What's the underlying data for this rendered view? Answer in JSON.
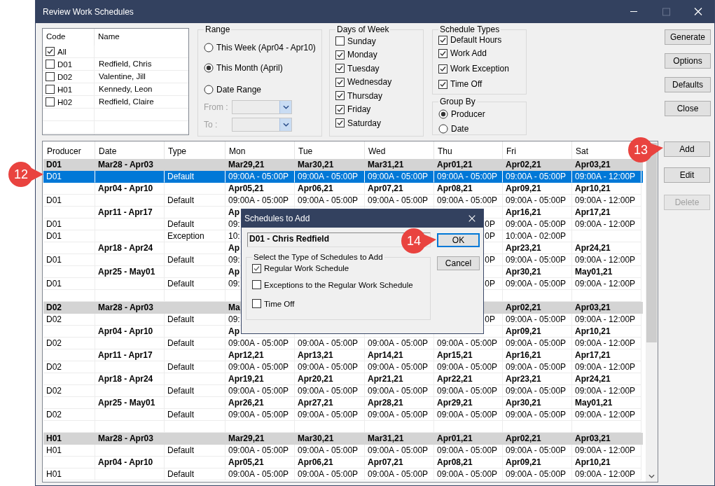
{
  "window": {
    "title": "Review Work Schedules",
    "controls": [
      {
        "kind": "minimize",
        "disabled": false
      },
      {
        "kind": "maximize",
        "disabled": true
      },
      {
        "kind": "close",
        "disabled": false
      }
    ]
  },
  "code_list": {
    "columns": [
      "Code",
      "Name"
    ],
    "rows": [
      {
        "code": "All",
        "checked": true
      },
      {
        "code": "D01",
        "name": "Redfield, Chris",
        "checked": false
      },
      {
        "code": "D02",
        "name": "Valentine, Jill",
        "checked": false
      },
      {
        "code": "H01",
        "name": "Kennedy, Leon",
        "checked": false
      },
      {
        "code": "H02",
        "name": "Redfield, Claire",
        "checked": false
      }
    ]
  },
  "range": {
    "title": "Range",
    "options": [
      {
        "label": "This Week (Apr04 - Apr10)",
        "selected": false
      },
      {
        "label": "This Month (April)",
        "selected": true
      },
      {
        "label": "Date Range",
        "selected": false
      }
    ],
    "from_label": "From :",
    "to_label": "To :",
    "dates_disabled": true
  },
  "days_of_week": {
    "title": "Days of Week",
    "days": [
      {
        "label": "Sunday",
        "checked": false
      },
      {
        "label": "Monday",
        "checked": true
      },
      {
        "label": "Tuesday",
        "checked": true
      },
      {
        "label": "Wednesday",
        "checked": true
      },
      {
        "label": "Thursday",
        "checked": true
      },
      {
        "label": "Friday",
        "checked": true
      },
      {
        "label": "Saturday",
        "checked": true
      }
    ]
  },
  "schedule_types": {
    "title": "Schedule Types",
    "types": [
      {
        "label": "Default Hours",
        "checked": true
      },
      {
        "label": "Work Add",
        "checked": true
      },
      {
        "label": "Work Exception",
        "checked": true
      },
      {
        "label": "Time Off",
        "checked": true
      }
    ]
  },
  "group_by": {
    "title": "Group By",
    "options": [
      {
        "label": "Producer",
        "selected": true
      },
      {
        "label": "Date",
        "selected": false
      }
    ]
  },
  "top_buttons": [
    {
      "label": "Generate",
      "disabled": false
    },
    {
      "label": "Options",
      "disabled": false
    },
    {
      "label": "Defaults",
      "disabled": false
    },
    {
      "label": "Close",
      "disabled": false
    }
  ],
  "table": {
    "callout": "12",
    "columns": [
      "Producer",
      "Date",
      "Type",
      "Mon",
      "Tue",
      "Wed",
      "Thu",
      "Fri",
      "Sat"
    ],
    "rows": [
      {
        "kind": "group",
        "selected": false,
        "cells": [
          "D01",
          "Mar28 - Apr03",
          null,
          "Mar29,21",
          "Mar30,21",
          "Mar31,21",
          "Apr01,21",
          "Apr02,21",
          "Apr03,21"
        ]
      },
      {
        "kind": "entry",
        "selected": true,
        "cells": [
          "D01",
          null,
          "Default",
          "09:00A - 05:00P",
          "09:00A - 05:00P",
          "09:00A - 05:00P",
          "09:00A - 05:00P",
          "09:00A - 05:00P",
          "09:00A - 12:00P"
        ]
      },
      {
        "kind": "week",
        "selected": false,
        "cells": [
          null,
          "Apr04 - Apr10",
          null,
          "Apr05,21",
          "Apr06,21",
          "Apr07,21",
          "Apr08,21",
          "Apr09,21",
          "Apr10,21"
        ]
      },
      {
        "kind": "entry",
        "selected": false,
        "cells": [
          "D01",
          null,
          "Default",
          "09:00A - 05:00P",
          "09:00A - 05:00P",
          "09:00A - 05:00P",
          "09:00A - 05:00P",
          "09:00A - 05:00P",
          "09:00A - 12:00P"
        ]
      },
      {
        "kind": "week",
        "selected": false,
        "cells": [
          null,
          "Apr11 - Apr17",
          null,
          "Ap",
          null,
          null,
          null,
          "Apr16,21",
          "Apr17,21"
        ]
      },
      {
        "kind": "entry",
        "selected": false,
        "cells": [
          "D01",
          null,
          "Default",
          "09:",
          null,
          null,
          {
            "text": "0P",
            "clipped_start": true
          },
          "09:00A - 05:00P",
          "09:00A - 12:00P"
        ]
      },
      {
        "kind": "entry",
        "selected": false,
        "cells": [
          "D01",
          null,
          "Exception",
          "10:",
          null,
          null,
          {
            "text": "0P",
            "clipped_start": true
          },
          "10:00A - 02:00P",
          null
        ]
      },
      {
        "kind": "week",
        "selected": false,
        "cells": [
          null,
          "Apr18 - Apr24",
          null,
          "Ap",
          null,
          null,
          null,
          "Apr23,21",
          "Apr24,21"
        ]
      },
      {
        "kind": "entry",
        "selected": false,
        "cells": [
          "D01",
          null,
          "Default",
          "09:",
          null,
          null,
          {
            "text": "0P",
            "clipped_start": true
          },
          "09:00A - 05:00P",
          "09:00A - 12:00P"
        ]
      },
      {
        "kind": "week",
        "selected": false,
        "cells": [
          null,
          "Apr25 - May01",
          null,
          "Ap",
          null,
          null,
          null,
          "Apr30,21",
          "May01,21"
        ]
      },
      {
        "kind": "entry",
        "selected": false,
        "cells": [
          "D01",
          null,
          "Default",
          "09:",
          null,
          null,
          {
            "text": "0P",
            "clipped_start": true
          },
          "09:00A - 05:00P",
          "09:00A - 12:00P"
        ]
      },
      {
        "kind": "blank",
        "selected": false
      },
      {
        "kind": "group",
        "selected": false,
        "cells": [
          "D02",
          "Mar28 - Apr03",
          null,
          "Ma",
          null,
          null,
          null,
          "Apr02,21",
          "Apr03,21"
        ]
      },
      {
        "kind": "entry",
        "selected": false,
        "cells": [
          "D02",
          null,
          "Default",
          "09:",
          null,
          null,
          {
            "text": "0P",
            "clipped_start": true
          },
          "09:00A - 05:00P",
          "09:00A - 12:00P"
        ]
      },
      {
        "kind": "week",
        "selected": false,
        "cells": [
          null,
          "Apr04 - Apr10",
          null,
          "Ap",
          null,
          null,
          null,
          "Apr09,21",
          "Apr10,21"
        ]
      },
      {
        "kind": "entry",
        "selected": false,
        "cells": [
          "D02",
          null,
          "Default",
          "09:00A - 05:00P",
          "09:00A - 05:00P",
          "09:00A - 05:00P",
          "09:00A - 05:00P",
          "09:00A - 05:00P",
          "09:00A - 12:00P"
        ]
      },
      {
        "kind": "week",
        "selected": false,
        "cells": [
          null,
          "Apr11 - Apr17",
          null,
          "Apr12,21",
          "Apr13,21",
          "Apr14,21",
          "Apr15,21",
          "Apr16,21",
          "Apr17,21"
        ]
      },
      {
        "kind": "entry",
        "selected": false,
        "cells": [
          "D02",
          null,
          "Default",
          "09:00A - 05:00P",
          "09:00A - 05:00P",
          "09:00A - 05:00P",
          "09:00A - 05:00P",
          "09:00A - 05:00P",
          "09:00A - 12:00P"
        ]
      },
      {
        "kind": "week",
        "selected": false,
        "cells": [
          null,
          "Apr18 - Apr24",
          null,
          "Apr19,21",
          "Apr20,21",
          "Apr21,21",
          "Apr22,21",
          "Apr23,21",
          "Apr24,21"
        ]
      },
      {
        "kind": "entry",
        "selected": false,
        "cells": [
          "D02",
          null,
          "Default",
          "09:00A - 05:00P",
          "09:00A - 05:00P",
          "09:00A - 05:00P",
          "09:00A - 05:00P",
          "09:00A - 05:00P",
          "09:00A - 12:00P"
        ]
      },
      {
        "kind": "week",
        "selected": false,
        "cells": [
          null,
          "Apr25 - May01",
          null,
          "Apr26,21",
          "Apr27,21",
          "Apr28,21",
          "Apr29,21",
          "Apr30,21",
          "May01,21"
        ]
      },
      {
        "kind": "entry",
        "selected": false,
        "cells": [
          "D02",
          null,
          "Default",
          "09:00A - 05:00P",
          "09:00A - 05:00P",
          "09:00A - 05:00P",
          "09:00A - 05:00P",
          "09:00A - 05:00P",
          "09:00A - 12:00P"
        ]
      },
      {
        "kind": "blank",
        "selected": false
      },
      {
        "kind": "group",
        "selected": false,
        "cells": [
          "H01",
          "Mar28 - Apr03",
          null,
          "Mar29,21",
          "Mar30,21",
          "Mar31,21",
          "Apr01,21",
          "Apr02,21",
          "Apr03,21"
        ]
      },
      {
        "kind": "entry",
        "selected": false,
        "cells": [
          "H01",
          null,
          "Default",
          "09:00A - 05:00P",
          "09:00A - 05:00P",
          "09:00A - 05:00P",
          "09:00A - 05:00P",
          "09:00A - 05:00P",
          "09:00A - 12:00P"
        ]
      },
      {
        "kind": "week",
        "selected": false,
        "cells": [
          null,
          "Apr04 - Apr10",
          null,
          "Apr05,21",
          "Apr06,21",
          "Apr07,21",
          "Apr08,21",
          "Apr09,21",
          "Apr10,21"
        ]
      },
      {
        "kind": "entry",
        "selected": false,
        "cells": [
          "H01",
          null,
          "Default",
          "09:00A - 05:00P",
          "09:00A - 05:00P",
          "09:00A - 05:00P",
          "09:00A - 05:00P",
          "09:00A - 05:00P",
          "09:00A - 12:00P"
        ]
      }
    ]
  },
  "side_buttons": [
    {
      "label": "Add",
      "disabled": false,
      "callout": "13"
    },
    {
      "label": "Edit",
      "disabled": false
    },
    {
      "label": "Delete",
      "disabled": true
    }
  ],
  "dialog": {
    "title": "Schedules to Add",
    "producer": "D01 - Chris Redfield",
    "group_title": "Select the Type of Schedules to Add",
    "options": [
      {
        "label": "Regular Work Schedule",
        "checked": true
      },
      {
        "label": "Exceptions to the Regular Work Schedule",
        "checked": false
      },
      {
        "label": "Time Off",
        "checked": false
      }
    ],
    "buttons": [
      {
        "label": "OK",
        "default": true,
        "callout": "14"
      },
      {
        "label": "Cancel",
        "default": false
      }
    ]
  }
}
